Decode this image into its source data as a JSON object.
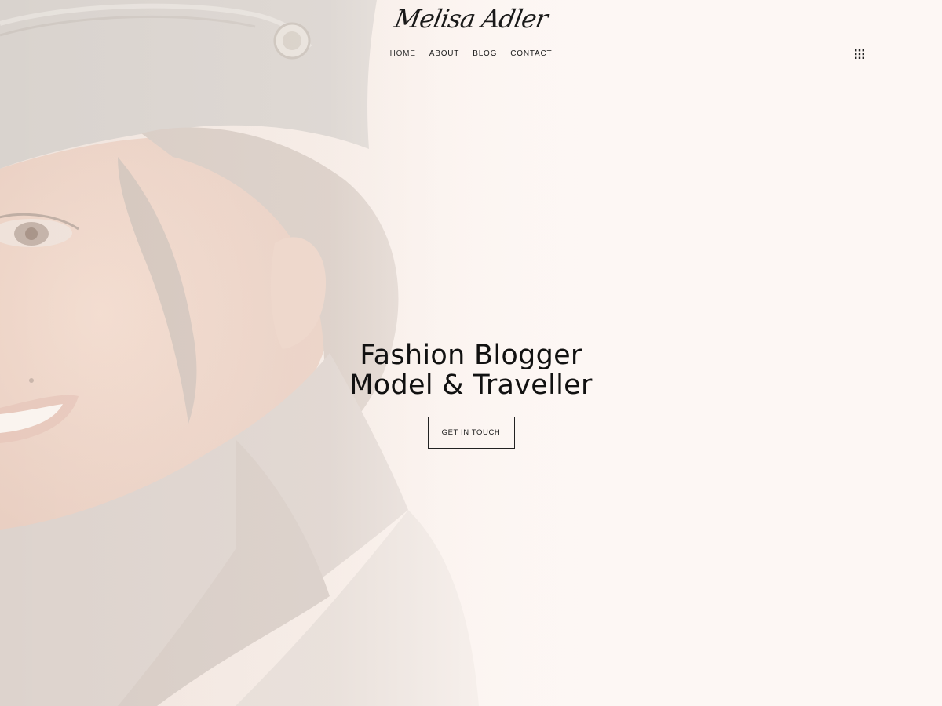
{
  "site": {
    "logo_text": "Melisa Adler"
  },
  "nav": {
    "items": [
      {
        "label": "HOME"
      },
      {
        "label": "ABOUT"
      },
      {
        "label": "BLOG"
      },
      {
        "label": "CONTACT"
      }
    ],
    "menu_icon": "grid-dots-icon"
  },
  "hero": {
    "line1": "Fashion Blogger",
    "line2": "Model & Traveller",
    "cta_label": "GET IN TOUCH",
    "background_image": "woman-in-cap-smiling-photo"
  },
  "colors": {
    "background": "#fcf6f2",
    "text": "#111111",
    "button_border": "#222222"
  }
}
